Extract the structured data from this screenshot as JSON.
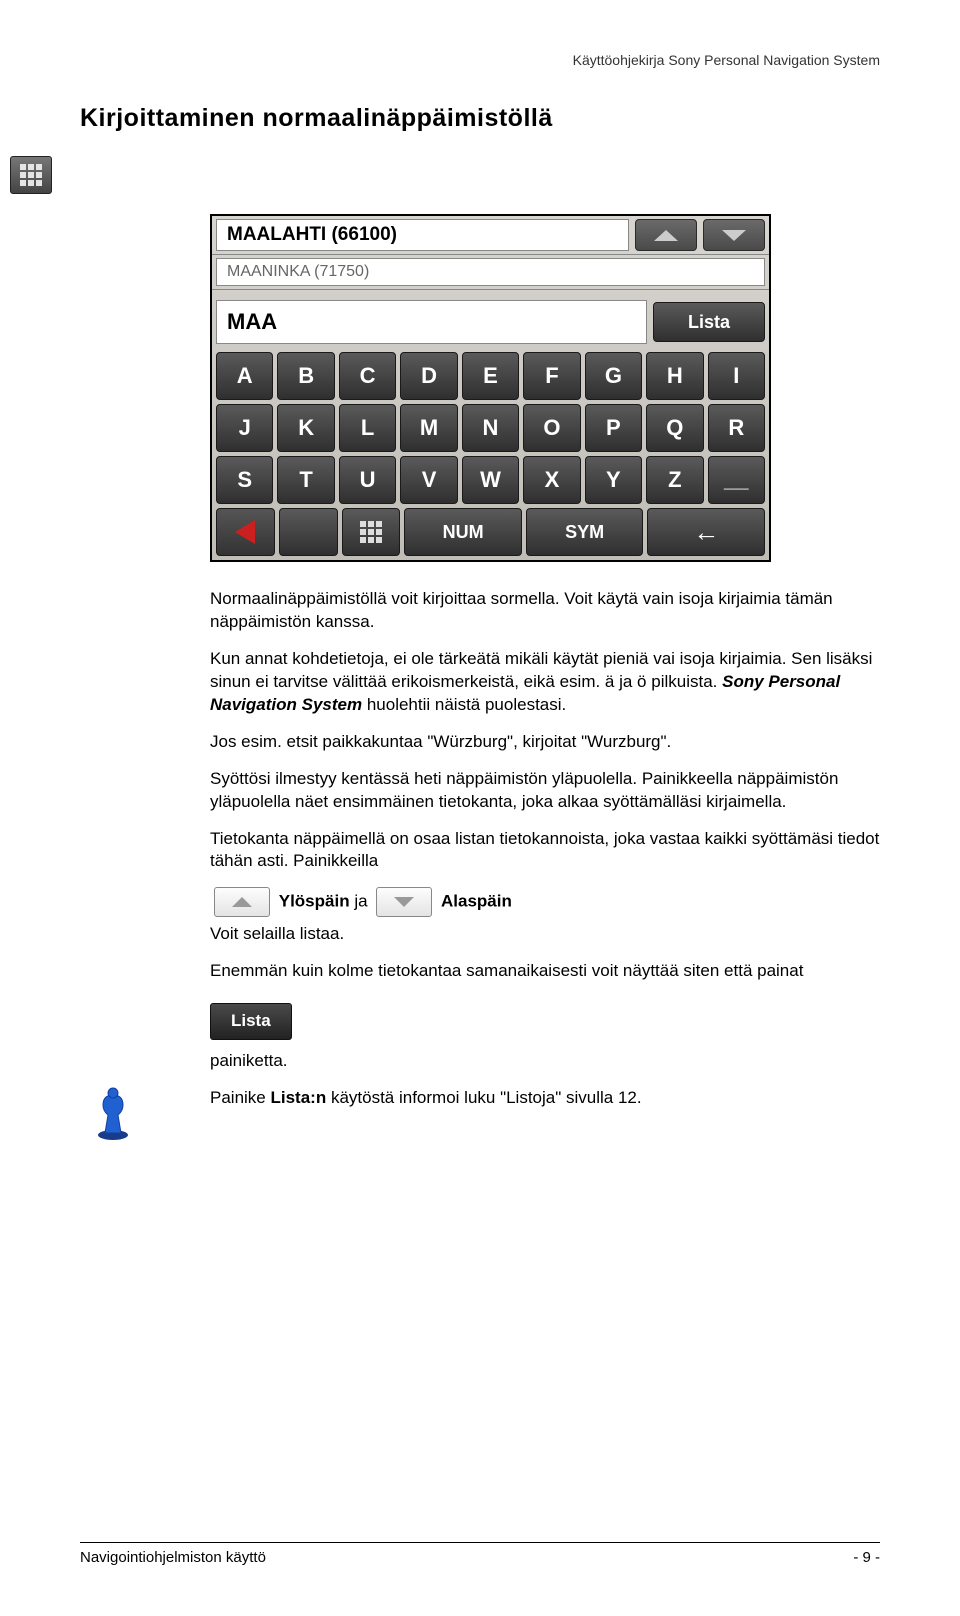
{
  "header": {
    "doc_title": "Käyttöohjekirja Sony Personal Navigation System"
  },
  "section": {
    "title": "Kirjoittaminen normaalinäppäimistöllä"
  },
  "keypad": {
    "sugg1": "MAALAHTI (66100)",
    "sugg2": "MAANINKA (71750)",
    "input_value": "MAA",
    "lista_label": "Lista",
    "rows": [
      [
        "A",
        "B",
        "C",
        "D",
        "E",
        "F",
        "G",
        "H",
        "I"
      ],
      [
        "J",
        "K",
        "L",
        "M",
        "N",
        "O",
        "P",
        "Q",
        "R"
      ],
      [
        "S",
        "T",
        "U",
        "V",
        "W",
        "X",
        "Y",
        "Z",
        "_"
      ]
    ],
    "bottom": {
      "num": "NUM",
      "sym": "SYM"
    }
  },
  "body": {
    "p1a": "Normaalinäppäimistöllä voit kirjoittaa sormella. Voit käytä vain isoja kirjaimia tämän näppäimistön kanssa.",
    "p2a": "Kun annat kohdetietoja, ei ole tärkeätä mikäli käytät pieniä vai isoja kirjaimia. Sen lisäksi sinun ei tarvitse välittää erikoismerkeistä, eikä esim. ä ja ö pilkuista. ",
    "p2b": "Sony Personal Navigation System",
    "p2c": " huolehtii näistä puolestasi.",
    "p3": "Jos esim. etsit paikkakuntaa \"Würzburg\", kirjoitat \"Wurzburg\".",
    "p4": "Syöttösi ilmestyy kentässä heti näppäimistön yläpuolella. Painikkeella näppäimistön yläpuolella näet ensimmäinen tietokanta, joka alkaa syöttämälläsi kirjaimella.",
    "p5": "Tietokanta näppäimellä on osaa listan tietokannoista, joka vastaa kaikki syöttämäsi tiedot tähän asti. Painikkeilla",
    "up_label": "Ylöspäin",
    "and_label": " ja ",
    "down_label": "Alaspäin",
    "p6": "Voit selailla listaa.",
    "p7": "Enemmän kuin kolme tietokantaa samanaikaisesti voit näyttää siten että painat",
    "lista_btn": "Lista",
    "p8": "painiketta.",
    "p9a": "Painike ",
    "p9b": "Lista:n",
    "p9c": " käytöstä informoi luku \"Listoja\" sivulla 12."
  },
  "footer": {
    "left": "Navigointiohjelmiston käyttö",
    "right": "- 9 -"
  }
}
